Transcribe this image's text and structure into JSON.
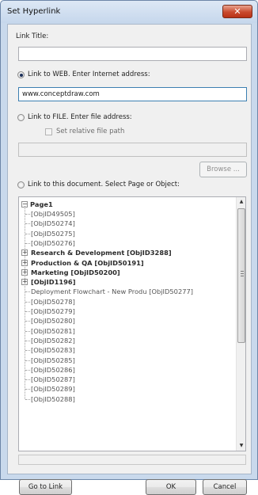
{
  "window": {
    "title": "Set Hyperlink",
    "close_label": "✕"
  },
  "link_title": {
    "label": "Link Title:",
    "value": ""
  },
  "web": {
    "label": "Link to WEB. Enter Internet address:",
    "checked": true,
    "value": "www.conceptdraw.com"
  },
  "file": {
    "label": "Link to FILE. Enter file address:",
    "checked": false,
    "relative_label": "Set relative file path",
    "value": "",
    "browse_label": "Browse ..."
  },
  "document": {
    "label": "Link to this document. Select Page or Object:",
    "checked": false
  },
  "tree": {
    "root": "Page1",
    "items": [
      {
        "text": "[ObjID49505]",
        "bold": false,
        "expander": false
      },
      {
        "text": "[ObjID50274]",
        "bold": false,
        "expander": false
      },
      {
        "text": "[ObjID50275]",
        "bold": false,
        "expander": false
      },
      {
        "text": "[ObjID50276]",
        "bold": false,
        "expander": false
      },
      {
        "text": "Research & Development [ObjID3288]",
        "bold": true,
        "expander": true
      },
      {
        "text": "Production & QA [ObjID50191]",
        "bold": true,
        "expander": true
      },
      {
        "text": "Marketing [ObjID50200]",
        "bold": true,
        "expander": true
      },
      {
        "text": "[ObjID1196]",
        "bold": true,
        "expander": true
      },
      {
        "text": "Deployment Flowchart - New Produ [ObjID50277]",
        "bold": false,
        "expander": false
      },
      {
        "text": "[ObjID50278]",
        "bold": false,
        "expander": false
      },
      {
        "text": "[ObjID50279]",
        "bold": false,
        "expander": false
      },
      {
        "text": "[ObjID50280]",
        "bold": false,
        "expander": false
      },
      {
        "text": "[ObjID50281]",
        "bold": false,
        "expander": false
      },
      {
        "text": "[ObjID50282]",
        "bold": false,
        "expander": false
      },
      {
        "text": "[ObjID50283]",
        "bold": false,
        "expander": false
      },
      {
        "text": "[ObjID50285]",
        "bold": false,
        "expander": false
      },
      {
        "text": "[ObjID50286]",
        "bold": false,
        "expander": false
      },
      {
        "text": "[ObjID50287]",
        "bold": false,
        "expander": false
      },
      {
        "text": "[ObjID50289]",
        "bold": false,
        "expander": false
      },
      {
        "text": "[ObjID50288]",
        "bold": false,
        "expander": false
      }
    ]
  },
  "buttons": {
    "go_to_link": "Go to Link",
    "ok": "OK",
    "cancel": "Cancel"
  }
}
